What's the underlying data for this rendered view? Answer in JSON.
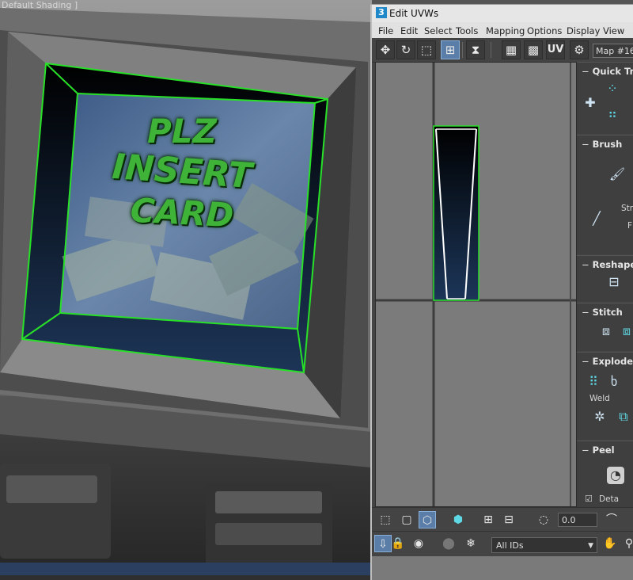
{
  "viewport": {
    "label": "Default Shading ]",
    "screen_text": [
      "PLZ",
      "INSERT",
      "CARD"
    ],
    "wire_color": "#28e028"
  },
  "window": {
    "app_icon_glyph": "3",
    "title": "Edit UVWs",
    "menu": [
      "File",
      "Edit",
      "Select",
      "Tools",
      "Mapping",
      "Options",
      "Display",
      "View"
    ],
    "toolbar": {
      "uv_label": "UV",
      "map_select": "Map #16 ("
    },
    "rollouts": [
      {
        "title": "Quick Tra"
      },
      {
        "title": "Brush",
        "labels": [
          "Str",
          "F"
        ]
      },
      {
        "title": "Reshape"
      },
      {
        "title": "Stitch"
      },
      {
        "title": "Explode",
        "labels": [
          "Weld"
        ]
      },
      {
        "title": "Peel",
        "labels": [
          "Deta"
        ]
      }
    ],
    "bottom": {
      "spinner_value": "0.0",
      "id_select": "All IDs"
    }
  },
  "colors": {
    "active_button": "#5a7ea8",
    "uv_background": "#7b7b7b",
    "wire": "#28e028"
  },
  "icons": {
    "move": "move-icon",
    "rotate": "rotate-icon",
    "scale": "scale-icon",
    "freeform": "freeform-icon",
    "mirror": "mirror-icon",
    "checker": "checker-pattern-icon",
    "options": "gear-icon",
    "lock": "lock-icon",
    "hand": "pan-hand-icon",
    "zoom": "zoom-icon",
    "snowflake": "freeze-icon"
  }
}
